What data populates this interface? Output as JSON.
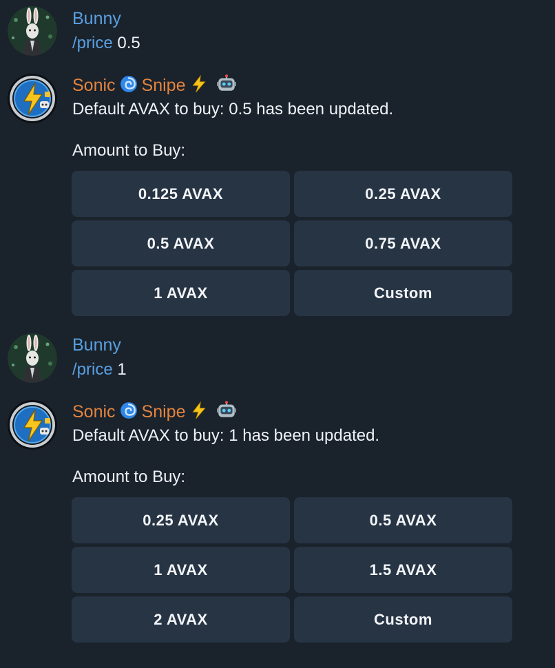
{
  "messages": [
    {
      "sender": "Bunny",
      "command": "/price",
      "argument": " 0.5"
    },
    {
      "sender_parts": [
        "Sonic",
        "Snipe"
      ],
      "text": "Default AVAX to buy: 0.5 has been updated.",
      "prompt": "Amount to Buy:",
      "buttons": [
        "0.125 AVAX",
        "0.25 AVAX",
        "0.5 AVAX",
        "0.75 AVAX",
        "1 AVAX",
        "Custom"
      ]
    },
    {
      "sender": "Bunny",
      "command": "/price",
      "argument": " 1"
    },
    {
      "sender_parts": [
        "Sonic",
        "Snipe"
      ],
      "text": "Default AVAX to buy: 1 has been updated.",
      "prompt": "Amount to Buy:",
      "buttons": [
        "0.25 AVAX",
        "0.5 AVAX",
        "1 AVAX",
        "1.5 AVAX",
        "2 AVAX",
        "Custom"
      ]
    }
  ],
  "colors": {
    "background": "#1a222c",
    "user_name": "#5aa0e0",
    "bot_name": "#e3843e",
    "button_bg": "#273444",
    "text": "#eef2f6"
  },
  "icons": [
    "bunny-avatar",
    "sonic-snipe-avatar",
    "cyclone-emoji-icon",
    "lightning-emoji-icon",
    "robot-emoji-icon"
  ]
}
